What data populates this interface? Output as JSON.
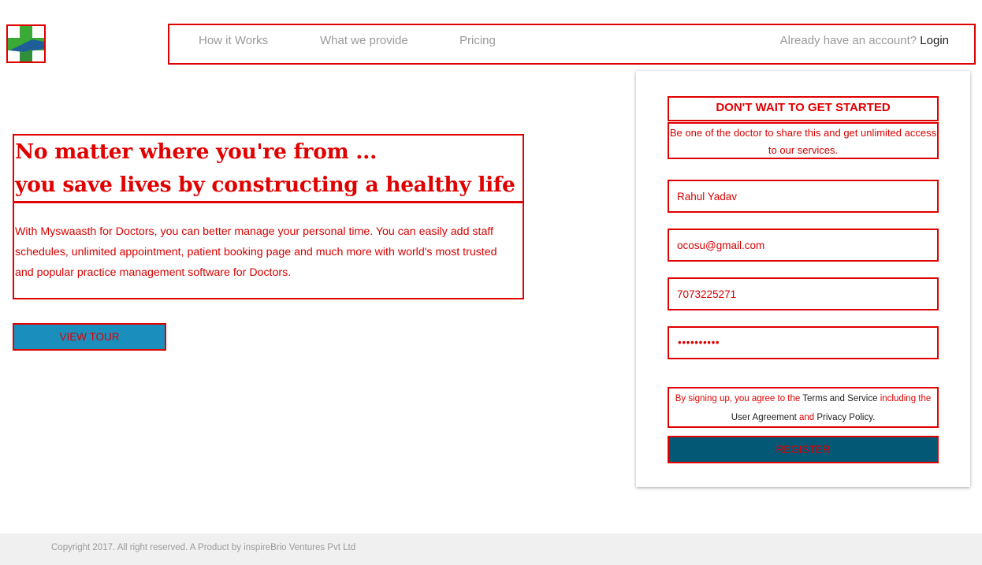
{
  "brand": {
    "logo_icon": "medical-cross-logo",
    "colors": {
      "cross_green": "#3aa936",
      "cross_blue": "#1f5f99",
      "accent_red": "#e00000",
      "tour_button": "#1a8fbd",
      "register_button": "#035876"
    }
  },
  "nav": {
    "items": [
      {
        "label": "How it Works"
      },
      {
        "label": "What we provide"
      },
      {
        "label": "Pricing"
      }
    ],
    "account_prompt": "Already have an account?",
    "login_label": "Login"
  },
  "hero": {
    "title_line1": "No matter where you're from ...",
    "title_line2": "you save lives by constructing a healthy life",
    "description": "With Myswaasth for Doctors, you can better manage your personal time. You can easily add staff schedules, unlimited appointment, patient booking page and much more with world's most trusted and popular practice management software for Doctors.",
    "view_tour_label": "VIEW TOUR"
  },
  "signup": {
    "heading": "DON'T WAIT TO GET STARTED",
    "subheading": "Be one of the doctor to share this and get unlimited access to our services.",
    "name_value": "Rahul Yadav",
    "email_value": "ocosu@gmail.com",
    "phone_value": "7073225271",
    "password_mask": "••••••••••",
    "terms": {
      "part1": "By signing up, you agree to the ",
      "link1": "Terms and Service",
      "part2": " including the ",
      "link2": "User Agreement",
      "part3": " and ",
      "link3": "Privacy Policy."
    },
    "register_label": "REGISTER"
  },
  "footer": {
    "copyright": "Copyright 2017. All right reserved. A Product by inspireBrio Ventures Pvt Ltd"
  }
}
